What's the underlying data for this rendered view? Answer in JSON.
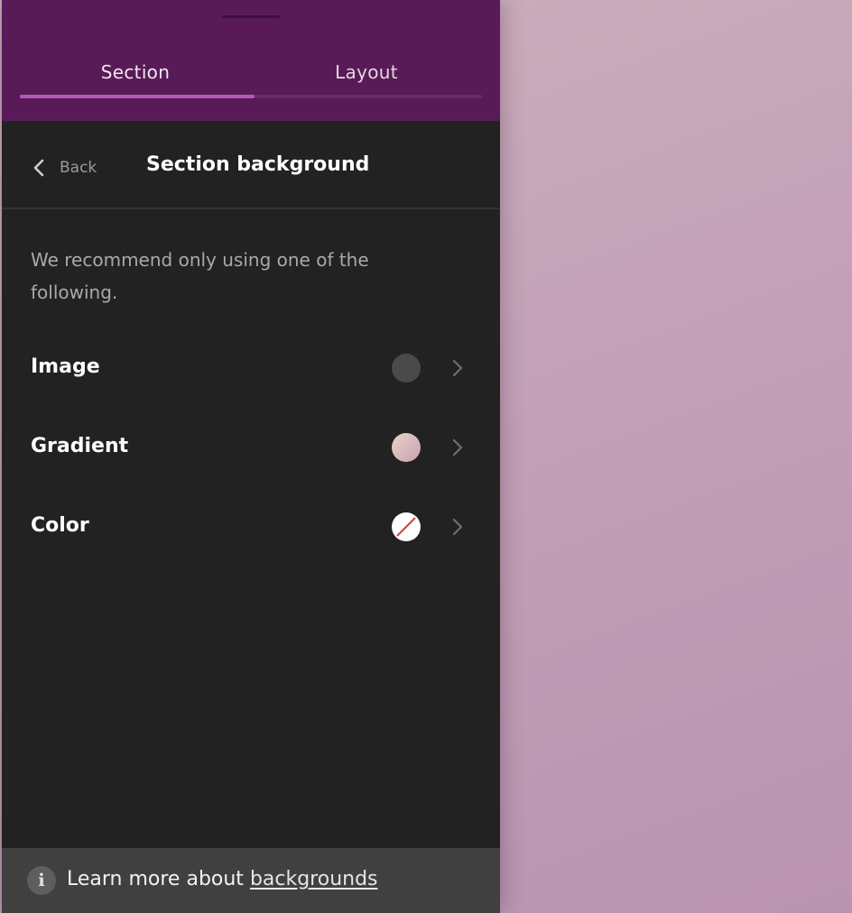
{
  "tabs": [
    {
      "label": "Section",
      "active": true
    },
    {
      "label": "Layout",
      "active": false
    }
  ],
  "subheader": {
    "back_label": "Back",
    "title": "Section background"
  },
  "recommend_text": "We recommend only using one of the following.",
  "options": [
    {
      "label": "Image",
      "swatch": "empty-dark",
      "swatch_color": "#4a4a4a"
    },
    {
      "label": "Gradient",
      "swatch": "gradient",
      "swatch_colors": [
        "#e8d5c6",
        "#c9a0b6"
      ]
    },
    {
      "label": "Color",
      "swatch": "none",
      "swatch_color": "#ffffff"
    }
  ],
  "footer": {
    "text": "Learn more about",
    "link": "backgrounds",
    "icon": "info-icon"
  },
  "colors": {
    "header_bg": "#581b58",
    "tab_indicator": "#b15ab8",
    "panel_bg": "#222222",
    "footer_bg": "#414041",
    "canvas_bg": "#c4a3b8"
  }
}
